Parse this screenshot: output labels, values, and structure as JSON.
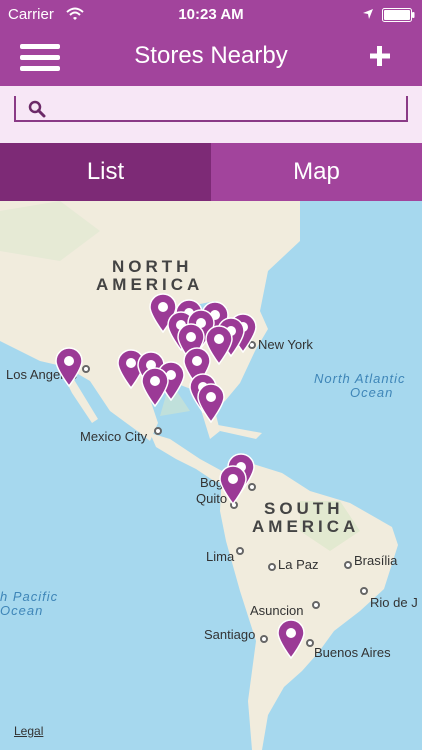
{
  "status_bar": {
    "carrier": "Carrier",
    "time": "10:23 AM",
    "wifi_icon": "wifi-icon",
    "location_icon": "location-arrow-icon",
    "battery_icon": "battery-icon"
  },
  "nav": {
    "title": "Stores Nearby",
    "menu_icon": "hamburger-menu-icon",
    "add_icon": "plus-icon"
  },
  "search": {
    "value": "",
    "placeholder": ""
  },
  "tabs": [
    {
      "label": "List",
      "selected": true
    },
    {
      "label": "Map",
      "selected": false
    }
  ],
  "map": {
    "regions": [
      "NORTH",
      "AMERICA",
      "SOUTH",
      "AMERICA"
    ],
    "oceans": [
      "North Atlantic",
      "Ocean",
      "h Pacific",
      "Ocean"
    ],
    "cities": [
      "Los Angeles",
      "New York",
      "Mexico City",
      "Bogotá",
      "Quito",
      "Lima",
      "La Paz",
      "Brasília",
      "Asuncion",
      "Rio de J",
      "Santiago",
      "Buenos Aires"
    ],
    "legal": "Legal"
  },
  "colors": {
    "brand": "#a2449c",
    "tab_active": "#7d2a76",
    "search_bg": "#f7e7f6",
    "ocean": "#a6d8ee",
    "land": "#f1ecdd",
    "pin": "#9b3a96"
  }
}
